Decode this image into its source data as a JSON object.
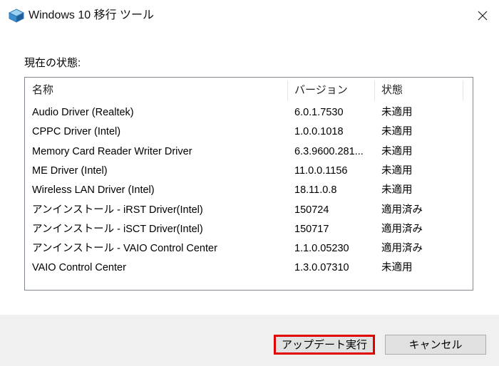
{
  "window": {
    "title": "Windows 10 移行 ツール",
    "close_symbol": "✕"
  },
  "status_label": "現在の状態:",
  "table": {
    "columns": [
      "名称",
      "バージョン",
      "状態"
    ],
    "rows": [
      {
        "name": "Audio Driver (Realtek)",
        "version": "6.0.1.7530",
        "status": "未適用"
      },
      {
        "name": "CPPC Driver (Intel)",
        "version": "1.0.0.1018",
        "status": "未適用"
      },
      {
        "name": "Memory Card Reader Writer Driver",
        "version": "6.3.9600.281...",
        "status": "未適用"
      },
      {
        "name": "ME Driver (Intel)",
        "version": "11.0.0.1156",
        "status": "未適用"
      },
      {
        "name": "Wireless LAN Driver (Intel)",
        "version": "18.11.0.8",
        "status": "未適用"
      },
      {
        "name": "アンインストール - iRST Driver(Intel)",
        "version": "150724",
        "status": "適用済み"
      },
      {
        "name": "アンインストール - iSCT Driver(Intel)",
        "version": "150717",
        "status": "適用済み"
      },
      {
        "name": "アンインストール - VAIO Control Center",
        "version": "1.1.0.05230",
        "status": "適用済み"
      },
      {
        "name": "VAIO Control Center",
        "version": "1.3.0.07310",
        "status": "未適用"
      }
    ]
  },
  "buttons": {
    "update": "アップデート実行",
    "cancel": "キャンセル"
  },
  "colors": {
    "footer_bg": "#f0f0f0",
    "highlight_border": "#e00000",
    "list_border": "#828790"
  },
  "icons": {
    "app": "windows-migration-app-icon",
    "close": "close-icon"
  }
}
